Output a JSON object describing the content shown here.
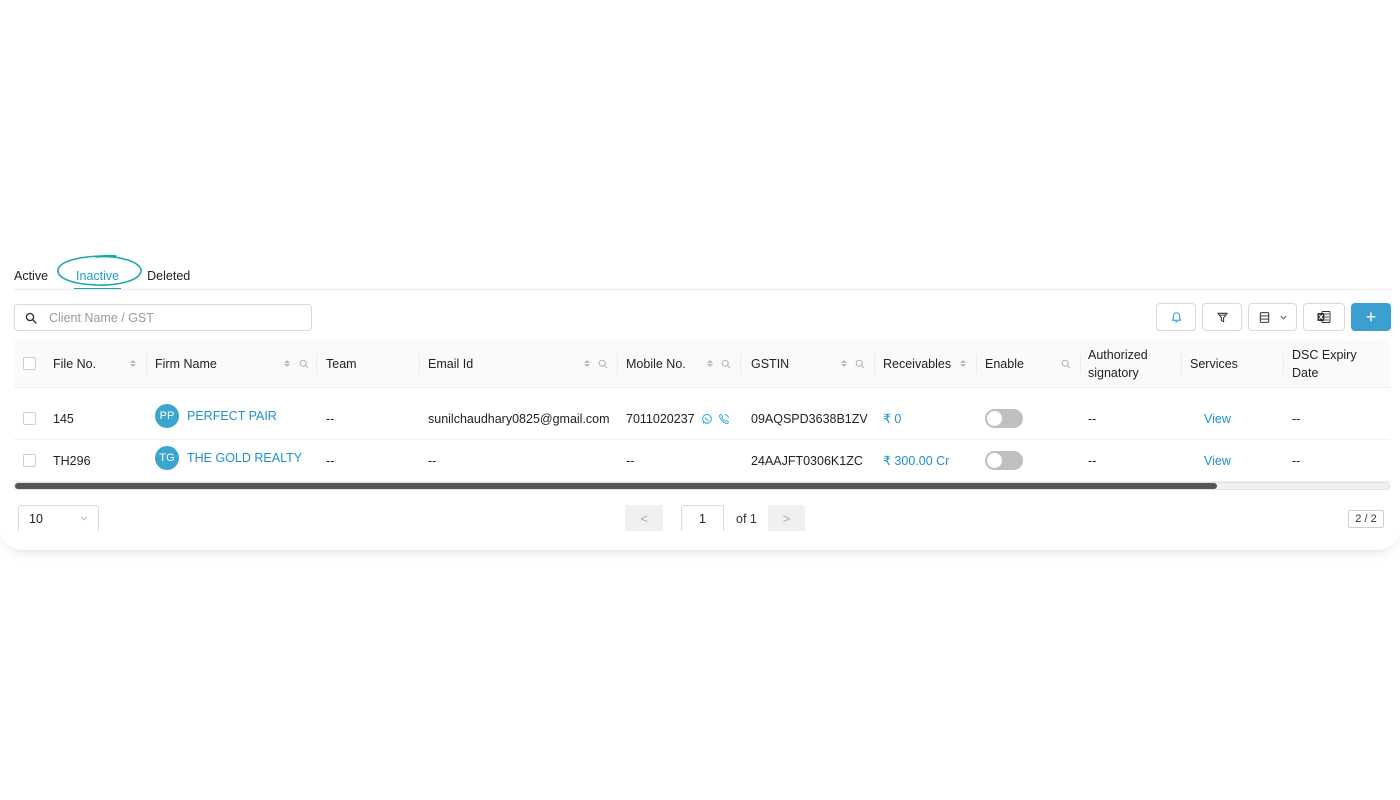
{
  "tabs": [
    {
      "label": "Active"
    },
    {
      "label": "Inactive",
      "selected": true
    },
    {
      "label": "Deleted"
    }
  ],
  "search": {
    "placeholder": "Client Name / GST",
    "value": ""
  },
  "toolbar": {
    "add_label": "+"
  },
  "table": {
    "headers": {
      "file_no": "File No.",
      "firm_name": "Firm Name",
      "team": "Team",
      "email": "Email Id",
      "mobile": "Mobile No.",
      "gstin": "GSTIN",
      "receivables": "Receivables",
      "enable": "Enable",
      "authorized_line1": "Authorized",
      "authorized_line2": "signatory",
      "services": "Services",
      "dsc_line1": "DSC Expiry",
      "dsc_line2": "Date"
    },
    "rows": [
      {
        "file_no": "145",
        "initials": "PP",
        "firm_name": "PERFECT PAIR",
        "team": "--",
        "email": "sunilchaudhary0825@gmail.com",
        "mobile": "7011020237",
        "gstin": "09AQSPD3638B1ZV",
        "receivables": "₹ 0",
        "enabled": false,
        "authorized": "--",
        "services": "View",
        "dsc": "--"
      },
      {
        "file_no": "TH296",
        "initials": "TG",
        "firm_name": "THE GOLD REALTY",
        "team": "--",
        "email": "--",
        "mobile": "--",
        "gstin": "24AAJFT0306K1ZC",
        "receivables": "₹ 300.00 Cr",
        "enabled": false,
        "authorized": "--",
        "services": "View",
        "dsc": "--"
      }
    ]
  },
  "pagination": {
    "page_size": "10",
    "prev_label": "<",
    "next_label": ">",
    "current_page": "1",
    "of_label": "of 1",
    "count": "2 / 2"
  },
  "colors": {
    "accent": "#3b9fd1",
    "link": "#1f8fd6",
    "annotation": "#1ea7ad"
  }
}
